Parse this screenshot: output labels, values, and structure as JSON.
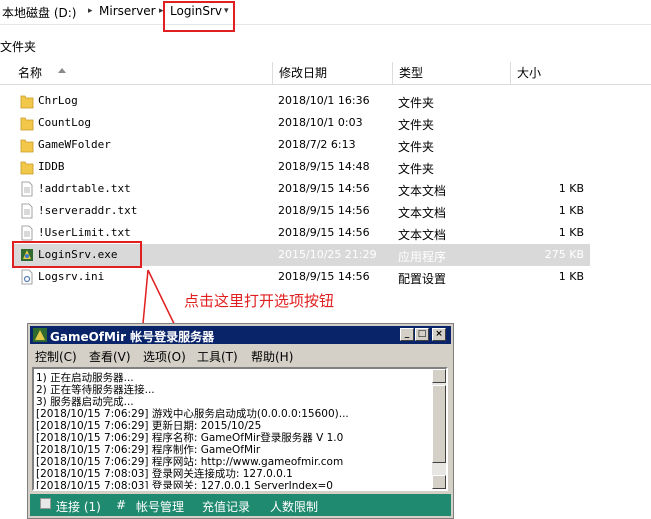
{
  "breadcrumb": {
    "items": [
      "本地磁盘 (D:)",
      "Mirserver",
      "LoginSrv"
    ]
  },
  "folder_label": "文件夹",
  "columns": {
    "name": "名称",
    "date": "修改日期",
    "type": "类型",
    "size": "大小"
  },
  "files": [
    {
      "name": "ChrLog",
      "date": "2018/10/1 16:36",
      "type": "文件夹",
      "size": "",
      "icon": "folder-icon"
    },
    {
      "name": "CountLog",
      "date": "2018/10/1 0:03",
      "type": "文件夹",
      "size": "",
      "icon": "folder-icon"
    },
    {
      "name": "GameWFolder",
      "date": "2018/7/2 6:13",
      "type": "文件夹",
      "size": "",
      "icon": "folder-icon"
    },
    {
      "name": "IDDB",
      "date": "2018/9/15 14:48",
      "type": "文件夹",
      "size": "",
      "icon": "folder-icon"
    },
    {
      "name": "!addrtable.txt",
      "date": "2018/9/15 14:56",
      "type": "文本文档",
      "size": "1 KB",
      "icon": "text-file-icon"
    },
    {
      "name": "!serveraddr.txt",
      "date": "2018/9/15 14:56",
      "type": "文本文档",
      "size": "1 KB",
      "icon": "text-file-icon"
    },
    {
      "name": "!UserLimit.txt",
      "date": "2018/9/15 14:56",
      "type": "文本文档",
      "size": "1 KB",
      "icon": "text-file-icon"
    },
    {
      "name": "LoginSrv.exe",
      "date": "2015/10/25 21:29",
      "type": "应用程序",
      "size": "275 KB",
      "icon": "exe-icon"
    },
    {
      "name": "Logsrv.ini",
      "date": "2018/9/15 14:56",
      "type": "配置设置",
      "size": "1 KB",
      "icon": "ini-file-icon"
    }
  ],
  "annotation": "点击这里打开选项按钮",
  "app": {
    "title": "GameOfMir 帐号登录服务器",
    "menu": [
      "控制(C)",
      "查看(V)",
      "选项(O)",
      "工具(T)",
      "帮助(H)"
    ],
    "log": [
      "1) 正在启动服务器...",
      "2) 正在等待服务器连接...",
      "3) 服务器启动完成...",
      "[2018/10/15 7:06:29] 游戏中心服务启动成功(0.0.0.0:15600)...",
      "[2018/10/15 7:06:29] 更新日期: 2015/10/25",
      "[2018/10/15 7:06:29] 程序名称: GameOfMir登录服务器 V 1.0",
      "[2018/10/15 7:06:29] 程序制作: GameOfMir",
      "[2018/10/15 7:06:29] 程序网站: http://www.gameofmir.com",
      "[2018/10/15 7:08:03] 登录网关连接成功: 127.0.0.1",
      "[2018/10/15 7:08:03] 登录网关: 127.0.0.1 ServerIndex=0"
    ],
    "status": {
      "connect": "连接 (1)",
      "hash": "#",
      "account": "帐号管理",
      "records": "充值记录",
      "limit": "人数限制"
    }
  },
  "colors": {
    "highlight": "#e02020",
    "titlebar": "#0a246a",
    "statusbar": "#1f8a6f"
  }
}
